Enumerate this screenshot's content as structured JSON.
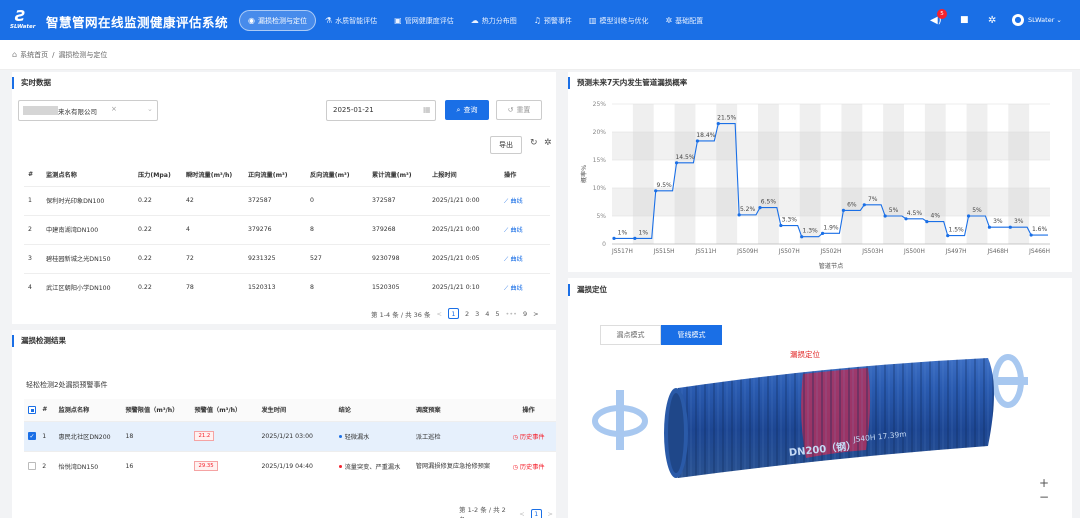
{
  "app": {
    "logo": "SLWater",
    "title": "智慧管网在线监测健康评估系统"
  },
  "nav": [
    {
      "label": "漏损检测与定位",
      "icon": "eye-icon",
      "active": true
    },
    {
      "label": "水质智能评估",
      "icon": "flask-icon"
    },
    {
      "label": "管网健康度评估",
      "icon": "briefcase-icon"
    },
    {
      "label": "热力分布图",
      "icon": "cloud-icon"
    },
    {
      "label": "预警事件",
      "icon": "bell-icon"
    },
    {
      "label": "模型训练与优化",
      "icon": "chart-icon"
    },
    {
      "label": "基础配置",
      "icon": "gear-icon"
    }
  ],
  "header": {
    "notif_count": "5",
    "user": "SLWater"
  },
  "breadcrumb": {
    "home": "系统首页",
    "sep": "/",
    "current": "漏损检测与定位"
  },
  "realtime": {
    "title": "实时数据",
    "company_tag": "来水有限公司",
    "date": "2025-01-21",
    "query": "查询",
    "reset": "重置",
    "export": "导出",
    "columns": [
      "#",
      "监测点名称",
      "压力(Mpa)",
      "瞬时流量(m³/h)",
      "正向流量(m³)",
      "反向流量(m³)",
      "累计流量(m³)",
      "上报时间",
      "操作"
    ],
    "rows": [
      [
        "1",
        "保利时光印象DN100",
        "0.22",
        "42",
        "372587",
        "0",
        "372587",
        "2025/1/21 0:00",
        "曲线"
      ],
      [
        "2",
        "中建南湖湾DN100",
        "0.22",
        "4",
        "379276",
        "8",
        "379268",
        "2025/1/21 0:00",
        "曲线"
      ],
      [
        "3",
        "碧桂园新城之光DN150",
        "0.22",
        "72",
        "9231325",
        "527",
        "9230798",
        "2025/1/21 0:05",
        "曲线"
      ],
      [
        "4",
        "武江区朝阳小学DN100",
        "0.22",
        "78",
        "1520313",
        "8",
        "1520305",
        "2025/1/21 0:10",
        "曲线"
      ]
    ],
    "pager": {
      "summary": "第 1-4 条 / 共 36 条",
      "pages": [
        "1",
        "2",
        "3",
        "4",
        "5",
        "•••",
        "9"
      ],
      "prev": "<",
      "next": ">"
    }
  },
  "leak": {
    "title": "漏损检测结果",
    "summary": "轻松检测2处漏损预警事件",
    "columns": [
      "",
      "#",
      "监测点名称",
      "预警限值（m³/h）",
      "预警值（m³/h）",
      "发生时间",
      "结论",
      "调度预案",
      "操作"
    ],
    "rows": [
      {
        "checked": true,
        "no": "1",
        "name": "惠民北社区DN200",
        "limit": "18",
        "value": "21.2",
        "time": "2025/1/21 03:00",
        "conclusion": "轻微漏水",
        "conclusion_color": "#1a6fe6",
        "plan": "派工巡检",
        "action": "历史事件"
      },
      {
        "checked": false,
        "no": "2",
        "name": "怡悦湾DN150",
        "limit": "16",
        "value": "29.35",
        "time": "2025/1/19 04:40",
        "conclusion": "流量突变、严重漏水",
        "conclusion_color": "#f5222d",
        "plan": "管网漏损修复应急抢修预案",
        "action": "历史事件"
      }
    ],
    "pager": {
      "summary": "第 1-2 条 / 共 2 条",
      "pages": [
        "1"
      ],
      "prev": "<",
      "next": ">"
    }
  },
  "prob": {
    "title": "预测未来7天内发生管道漏损概率",
    "chart_data": {
      "type": "line",
      "step": true,
      "title": "预测未来7天内发生管道漏损概率",
      "xlabel": "管道节点",
      "ylabel": "概率%",
      "ylim": [
        0,
        25
      ],
      "yticks": [
        "0",
        "5%",
        "10%",
        "15%",
        "20%",
        "25%"
      ],
      "xtick_labels": [
        "JS517H",
        "JS515H",
        "JS511H",
        "JS509H",
        "JS507H",
        "JS502H",
        "JS503H",
        "JS500H",
        "JS497H",
        "JS468H",
        "JS466H"
      ],
      "values": [
        1,
        1,
        9.5,
        14.5,
        18.4,
        21.5,
        5.2,
        6.5,
        3.3,
        1.3,
        1.9,
        6,
        7,
        5,
        4.5,
        4,
        1.5,
        5,
        3,
        3,
        1.6
      ],
      "labels": [
        "1%",
        "1%",
        "9.5%",
        "14.5%",
        "18.4%",
        "21.5%",
        "5.2%",
        "6.5%",
        "3.3%",
        "1.3%",
        "1.9%",
        "6%",
        "7%",
        "5%",
        "4.5%",
        "4%",
        "1.5%",
        "5%",
        "3%",
        "3%",
        "1.6%"
      ],
      "grid": true,
      "series_color": "#1a6fe6"
    }
  },
  "locate": {
    "title": "漏损定位",
    "modes": [
      "漏点模式",
      "管线模式"
    ],
    "active_mode": 1,
    "leak_label": "漏损定位",
    "pipe_label": "DN200（钢）",
    "segment_label": "JS40H 17.39m",
    "zoom_in": "+",
    "zoom_out": "−"
  }
}
